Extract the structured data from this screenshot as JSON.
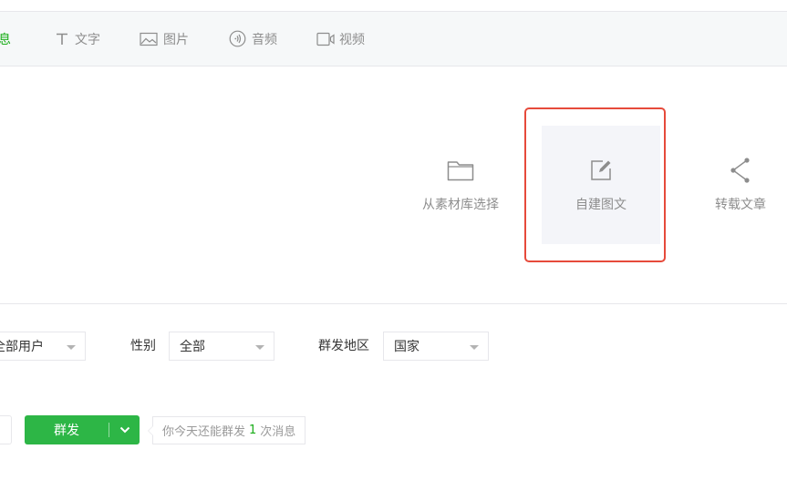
{
  "tabs": [
    {
      "label": "息",
      "icon": "",
      "active": true
    },
    {
      "label": "文字",
      "icon": "text-icon"
    },
    {
      "label": "图片",
      "icon": "image-icon"
    },
    {
      "label": "音频",
      "icon": "audio-icon"
    },
    {
      "label": "视频",
      "icon": "video-icon"
    }
  ],
  "materials": {
    "library": {
      "label": "从素材库选择",
      "icon": "folder-icon"
    },
    "create": {
      "label": "自建图文",
      "icon": "edit-icon"
    },
    "share": {
      "label": "转载文章",
      "icon": "share-icon"
    }
  },
  "filters": {
    "users": {
      "value": "全部用户"
    },
    "gender": {
      "label": "性别",
      "value": "全部"
    },
    "region": {
      "label": "群发地区",
      "value": "国家"
    }
  },
  "send": {
    "button_label": "群发",
    "tip_prefix": "你今天还能群发",
    "tip_count": "1",
    "tip_suffix": "次消息"
  },
  "colors": {
    "accent": "#1aad19",
    "button": "#2db646",
    "highlight": "#e64a3b"
  }
}
